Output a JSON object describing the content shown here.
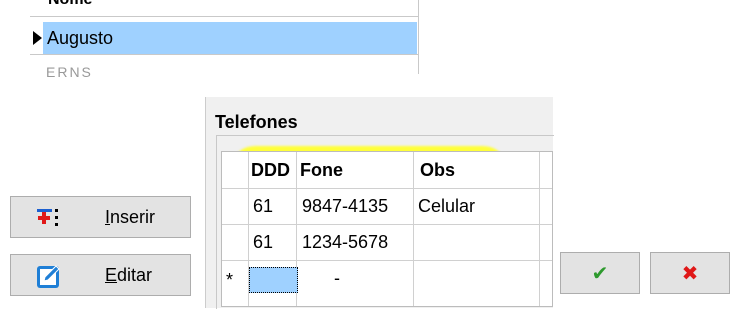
{
  "names_grid": {
    "header_partial": "Nome",
    "selected_row": "Augusto",
    "next_row_partial": "ERNS"
  },
  "phones": {
    "title": "Telefones",
    "columns": [
      "DDD",
      "Fone",
      "Obs"
    ],
    "rows": [
      {
        "ddd": "61",
        "fone": "9847-4135",
        "obs": "Celular"
      },
      {
        "ddd": "61",
        "fone": "1234-5678",
        "obs": ""
      }
    ],
    "new_row": {
      "marker": "*",
      "fone": "-"
    }
  },
  "buttons": {
    "insert_label": "Inserir",
    "insert_accel": "I",
    "insert_rest": "nserir",
    "edit_label": "Editar",
    "edit_accel": "E",
    "edit_rest": "ditar",
    "confirm_glyph": "✔",
    "cancel_glyph": "✖"
  },
  "colors": {
    "selection": "#9fd1ff",
    "highlight": "#ffff3a",
    "confirm": "#2e9a2e",
    "cancel": "#e01818",
    "edit_icon": "#1f7fd6",
    "insert_icon_red": "#e01818",
    "insert_icon_blue": "#1b5fd0"
  }
}
